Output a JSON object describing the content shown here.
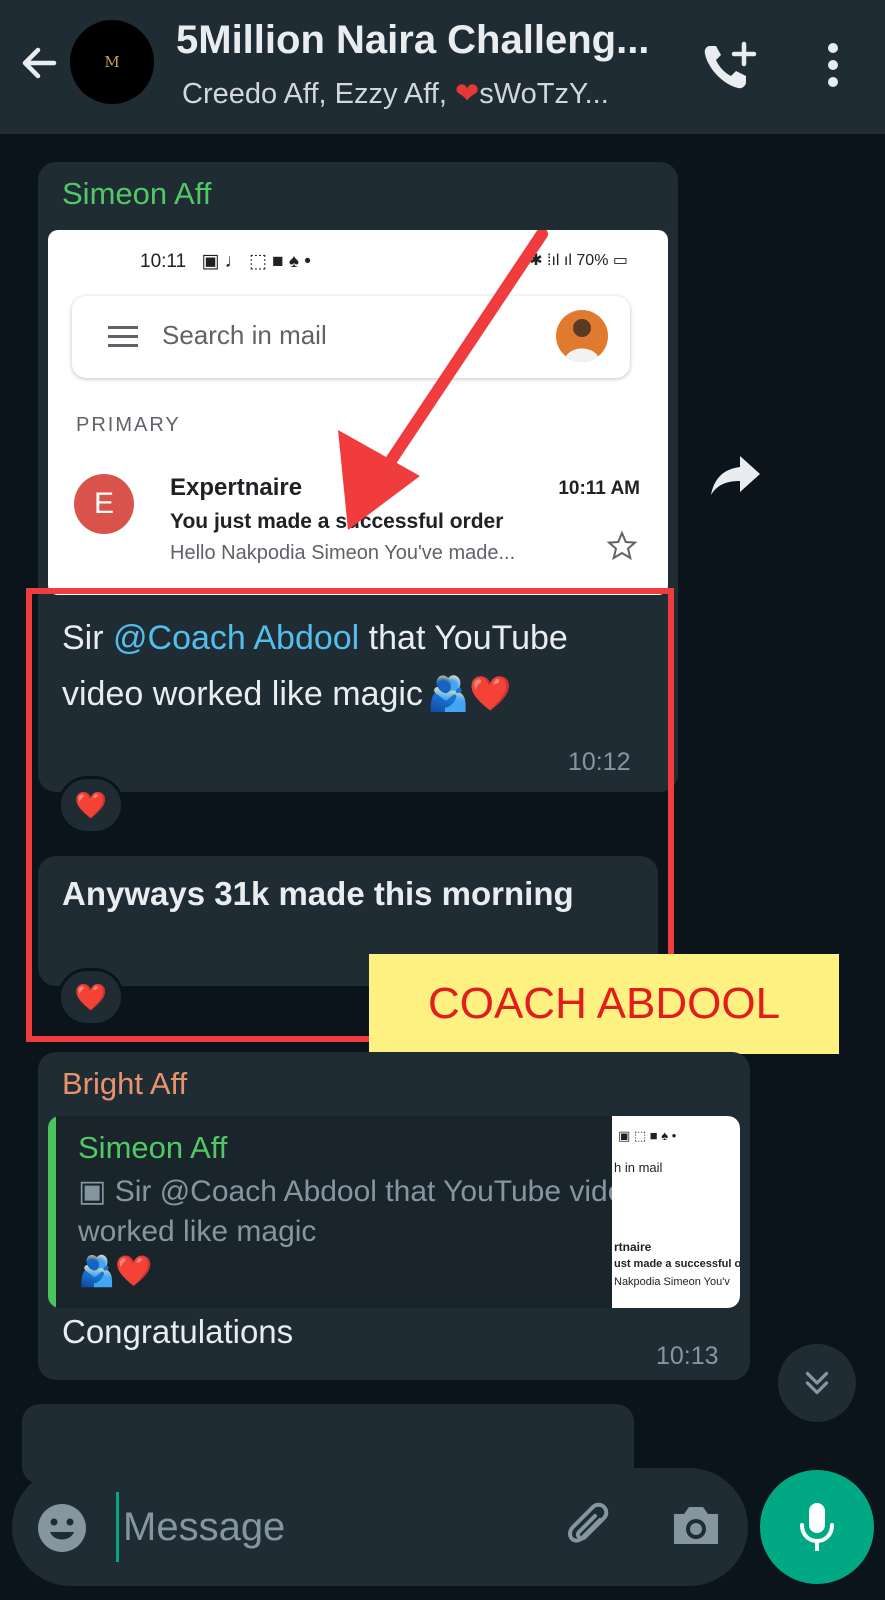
{
  "header": {
    "avatar_letter": "M",
    "title": "5Million Naira Challeng...",
    "subtitle_part1": "Creedo Aff,  Ezzy Aff, ",
    "subtitle_heart": "❤",
    "subtitle_part2": "sWoTzY..."
  },
  "messages": {
    "simeon": {
      "sender": "Simeon Aff",
      "screenshot": {
        "status_time": "10:11",
        "status_battery": "70%",
        "search_placeholder": "Search in mail",
        "section": "PRIMARY",
        "mail_avatar_letter": "E",
        "mail_sender": "Expertnaire",
        "mail_time": "10:11 AM",
        "mail_subject": "You just made a successful order",
        "mail_snippet": "Hello Nakpodia Simeon You've made..."
      },
      "text_before_mention": "Sir ",
      "mention": "@Coach Abdool",
      "text_after_mention": " that YouTube video worked like magic",
      "emoji": "🫂❤️",
      "time": "10:12",
      "reaction": "❤️"
    },
    "simeon_2": {
      "text": "Anyways 31k made this morning",
      "reaction": "❤️"
    },
    "annotation_label": "COACH ABDOOL",
    "bright": {
      "sender": "Bright Aff",
      "quote_sender": "Simeon Aff",
      "quote_text": "Sir @Coach Abdool that YouTube video worked like magic",
      "quote_emoji": "🫂❤️",
      "quote_thumb_lines": [
        "h in mail",
        "rtnaire",
        "ust made a successful o",
        "Nakpodia Simeon You'v"
      ],
      "text": "Congratulations",
      "time": "10:13"
    }
  },
  "composer": {
    "placeholder": "Message"
  },
  "colors": {
    "header_bg": "#1f2c34",
    "chat_bg": "#0b141a",
    "accent": "#00a884",
    "mention": "#53bdeb",
    "highlight_border": "#f03c3c",
    "label_bg": "#fdf181"
  }
}
